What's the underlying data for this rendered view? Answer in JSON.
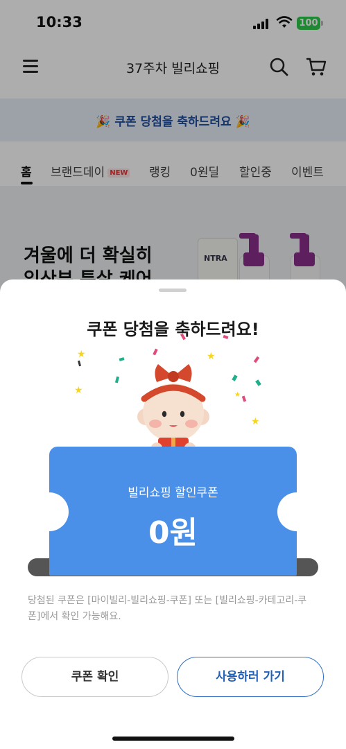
{
  "status_bar": {
    "time": "10:33",
    "battery": "100"
  },
  "header": {
    "title": "37주차 빌리쇼핑",
    "menu_icon": "hamburger-icon",
    "search_icon": "search-icon",
    "cart_icon": "cart-icon"
  },
  "banner": {
    "text": "🎉 쿠폰 당첨을 축하드려요 🎉"
  },
  "tabs": [
    {
      "label": "홈",
      "active": true
    },
    {
      "label": "브랜드데이",
      "badge": "NEW"
    },
    {
      "label": "랭킹"
    },
    {
      "label": "0원딜"
    },
    {
      "label": "할인중"
    },
    {
      "label": "이벤트"
    }
  ],
  "hero": {
    "title_line1": "겨울에 더 확실히",
    "title_line2": "임산부 튼살 케어",
    "product_label": "NTRA"
  },
  "sheet": {
    "title": "쿠폰 당첨을 축하드려요!",
    "ticket_label": "빌리쇼핑 할인쿠폰",
    "ticket_amount": "0원",
    "notice": "당첨된 쿠폰은 [마이빌리-빌리쇼핑-쿠폰] 또는 [빌리쇼핑-카테고리-쿠폰]에서 확인 가능해요.",
    "check_button": "쿠폰 확인",
    "go_button": "사용하러 가기"
  },
  "colors": {
    "ticket": "#4a90e8",
    "accent": "#1f5fb8",
    "banner_text": "#1f4fa0",
    "battery": "#2fc94a"
  }
}
